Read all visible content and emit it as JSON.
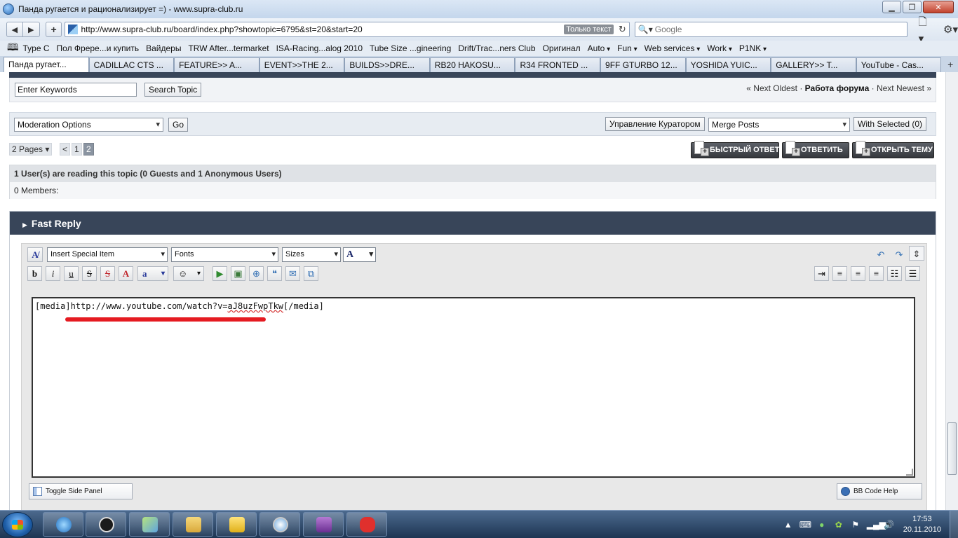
{
  "window": {
    "title": "Панда ругается и рационализирует =) - www.supra-club.ru"
  },
  "nav": {
    "url": "http://www.supra-club.ru/board/index.php?showtopic=6795&st=20&start=20",
    "reader_badge": "Только текст",
    "search_placeholder": "Google"
  },
  "bookmarks": [
    "Type C",
    "Пол Фрере...и купить",
    "Вайдеры",
    "TRW After...termarket",
    "ISA-Racing...alog 2010",
    "Tube Size ...gineering",
    "Drift/Trac...ners Club",
    "Оригинал"
  ],
  "bookmark_folders": [
    "Auto",
    "Fun",
    "Web services",
    "Work",
    "P1NK"
  ],
  "tabs": [
    "Панда ругает...",
    "CADILLAC CTS ...",
    "FEATURE>> A...",
    "EVENT>>THE 2...",
    "BUILDS>>DRE...",
    "RB20 HAKOSU...",
    "R34 FRONTED ...",
    "9FF GTURBO 12...",
    "YOSHIDA YUIC...",
    "GALLERY>> T...",
    "YouTube - Cas..."
  ],
  "search": {
    "placeholder": "Enter Keywords",
    "button": "Search Topic"
  },
  "topic_nav": {
    "prev": "« Next Oldest",
    "sep1": "·",
    "forum": "Работа форума",
    "sep2": "·",
    "next": "Next Newest »"
  },
  "moderation": {
    "select": "Moderation Options",
    "go": "Go",
    "curator": "Управление Куратором",
    "merge": "Merge Posts",
    "with_selected": "With Selected (0)"
  },
  "pagination": {
    "count": "2 Pages",
    "prev": "<",
    "pages": [
      "1",
      "2"
    ]
  },
  "actions": {
    "quick_reply": "БЫСТРЫЙ ОТВЕТ",
    "reply": "ОТВЕТИТЬ",
    "new_topic": "ОТКРЫТЬ ТЕМУ"
  },
  "readers": {
    "count": "1",
    "text": " User(s) are reading this topic (0 Guests and 1 Anonymous Users)",
    "members": "0 Members:"
  },
  "fast_reply": {
    "title": "Fast Reply",
    "special": "Insert Special Item",
    "fonts": "Fonts",
    "sizes": "Sizes",
    "color": "A",
    "text_prefix": "[media]http://www.youtube.com/watch?v=",
    "text_id": "aJ8uzFwpTkw",
    "text_suffix": "[/media]",
    "toggle_side": "Toggle Side Panel",
    "bbcode_help": "BB Code Help"
  },
  "format_buttons": {
    "bold": "b",
    "italic": "i",
    "underline": "u",
    "strike": "S",
    "remove": "S",
    "font_color": "A",
    "highlight": "a"
  },
  "clock": {
    "time": "17:53",
    "date": "20.11.2010"
  },
  "colors": {
    "header_bar": "#384559",
    "annotation": "#e51b21"
  }
}
